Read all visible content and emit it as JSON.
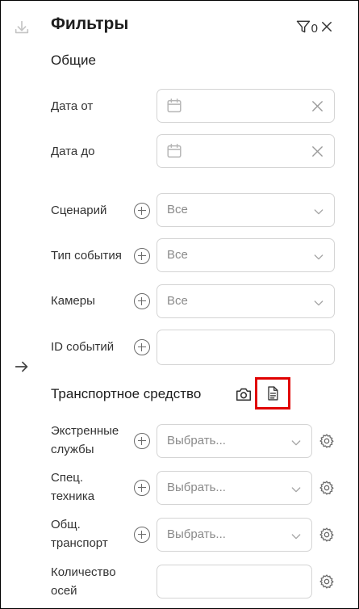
{
  "header": {
    "title": "Фильтры",
    "filter_count": "0"
  },
  "sections": {
    "general": "Общие",
    "transport": "Транспортное средство"
  },
  "date_from": {
    "label": "Дата от"
  },
  "date_to": {
    "label": "Дата до"
  },
  "scenario": {
    "label": "Сценарий",
    "value": "Все"
  },
  "event_type": {
    "label": "Тип события",
    "value": "Все"
  },
  "cameras": {
    "label": "Камеры",
    "value": "Все"
  },
  "event_ids": {
    "label": "ID событий"
  },
  "emergency": {
    "label_line1": "Экстренные",
    "label_line2": "службы",
    "placeholder": "Выбрать..."
  },
  "special": {
    "label_line1": "Спец.",
    "label_line2": "техника",
    "placeholder": "Выбрать..."
  },
  "public": {
    "label_line1": "Общ.",
    "label_line2": "транспорт",
    "placeholder": "Выбрать..."
  },
  "axles": {
    "label_line1": "Количество",
    "label_line2": "осей"
  },
  "colors": {
    "highlight": "#e00000",
    "border": "#d4d4d4"
  }
}
